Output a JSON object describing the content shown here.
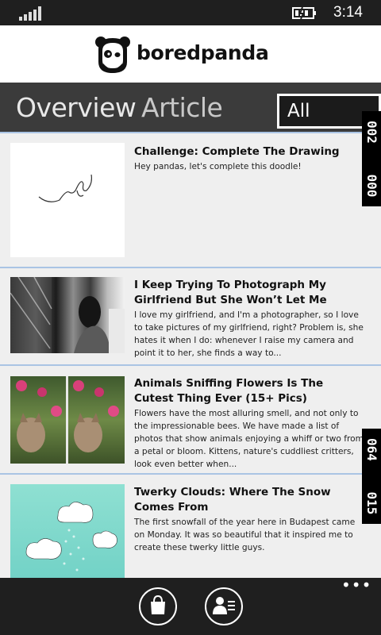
{
  "status": {
    "time": "3:14"
  },
  "brand": {
    "name": "boredpanda"
  },
  "pivot": {
    "tab_overview": "Overview",
    "tab_article": "Article",
    "filter_value": "All"
  },
  "counters": [
    {
      "top": "002",
      "bottom": "000"
    },
    {
      "top": "064",
      "bottom": "015"
    }
  ],
  "items": [
    {
      "title": "Challenge: Complete The Drawing",
      "body": "Hey pandas, let's complete this doodle!"
    },
    {
      "title": "I Keep Trying To Photograph My Girlfriend But She Won’t Let Me",
      "body": "I love my girlfriend, and I'm a photographer, so I love to take pictures of my girlfriend, right? Problem is, she hates it when I do: whenever I raise my camera and point it to her, she finds a way to..."
    },
    {
      "title": "Animals Sniffing Flowers Is The Cutest Thing Ever (15+ Pics)",
      "body": "Flowers have the most alluring smell, and not only to the impressionable bees. We have made a list of photos that show animals enjoying a whiff or two from a petal or bloom. Kittens, nature's cuddliest critters, look even better when..."
    },
    {
      "title": "Twerky Clouds: Where The Snow Comes From",
      "body": "The first snowfall of the year here in Budapest came on Monday. It was so beautiful that it inspired me to create these twerky little guys."
    }
  ],
  "appbar": {
    "more_label": "•••"
  },
  "icons": {
    "signal": "signal-strength-icon",
    "battery": "battery-charging-icon",
    "logo": "panda-logo-icon",
    "store": "shopping-bag-icon",
    "profile": "profile-list-icon",
    "more": "more-options-icon"
  }
}
